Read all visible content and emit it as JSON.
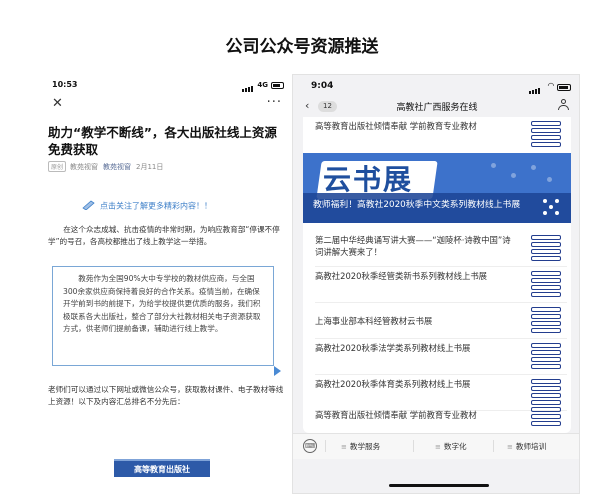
{
  "page": {
    "title": "公司公众号资源推送"
  },
  "left_phone": {
    "status": {
      "time": "10:53",
      "network": "4G"
    },
    "nav": {
      "close_icon": "close-icon",
      "more_icon": "more-icon"
    },
    "article": {
      "headline": "助力“教学不断线”，各大出版社线上资源免费获取",
      "meta": {
        "tag": "原创",
        "account": "教苑视窗",
        "link": "教苑视窗",
        "date": "2月11日"
      },
      "follow_text": "点击关注了解更多精彩内容！！",
      "paragraph1": "在这个众志成城、抗击疫情的非常时期，为响应教育部“停课不停学”的号召，各高校都推出了线上教学这一举措。",
      "highlight_box": "教苑作为全国90%大中专学校的教材供应商，与全国300余家供应商保持着良好的合作关系。疫情当前，在确保开学前到书的前提下，为给学校提供更优质的服务，我们积极联系各大出版社，整合了部分大社教材相关电子资源获取方式，供老师们提前备课，辅助进行线上教学。",
      "paragraph2": "老师们可以通过以下网址或微信公众号，获取教材课件、电子教材等线上资源！以下及内容汇总排名不分先后：",
      "publisher_label": "高等教育出版社"
    }
  },
  "right_phone": {
    "status": {
      "time": "9:04"
    },
    "nav": {
      "badge": "12",
      "title": "高教社广西服务在线"
    },
    "top_item": "高等教育出版社倾情奉献 学前教育专业教材",
    "banner": {
      "art_text": "云书展",
      "caption": "教师福利！高教社2020秋季中文类系列教材线上书展"
    },
    "items": [
      {
        "title": "第二届中华经典诵写讲大赛——“迦陵杯·诗教中国”诗词讲解大赛来了！"
      },
      {
        "title": "高教社2020秋季经管类新书系列教材线上书展"
      },
      {
        "title": "上海事业部本科经管教材云书展"
      },
      {
        "title": "高教社2020秋季法学类系列教材线上书展"
      },
      {
        "title": "高教社2020秋季体育类系列教材线上书展"
      },
      {
        "title": "高等教育出版社倾情奉献 学前教育专业教材"
      }
    ],
    "tabbar": {
      "tabs": [
        "教学服务",
        "数字化",
        "教师培训"
      ]
    },
    "colors": {
      "banner": "#3d72cb",
      "thumb": "#233d8e"
    }
  }
}
